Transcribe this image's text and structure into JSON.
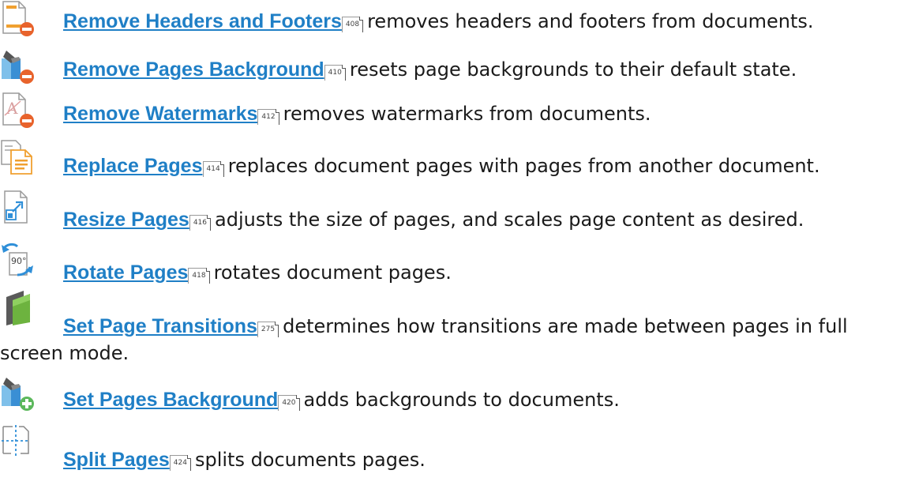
{
  "items": [
    {
      "link": "Remove Headers and Footers",
      "page": "408",
      "text": "removes headers and footers from documents.",
      "icon": "remove-headers-footers-icon"
    },
    {
      "link": " Remove Pages Background",
      "page": "410",
      "text": "resets page backgrounds to their default state.",
      "icon": "remove-background-icon"
    },
    {
      "link": "Remove Watermarks",
      "page": "412",
      "text": "removes watermarks from documents.",
      "icon": "remove-watermark-icon"
    },
    {
      "link": "Replace Pages",
      "page": "414",
      "text": "replaces document pages with pages from another document.",
      "icon": "replace-pages-icon"
    },
    {
      "link": "Resize Pages",
      "page": "416",
      "text": "adjusts the size of pages, and scales page content as desired.",
      "icon": "resize-pages-icon"
    },
    {
      "link": "Rotate Pages",
      "page": "418",
      "text": "rotates document pages.",
      "icon": "rotate-pages-icon"
    },
    {
      "link": "Set Page Transitions",
      "page": "275",
      "text": "determines how transitions are made between pages in full screen mode.",
      "icon": "page-transitions-icon"
    },
    {
      "link": "Set Pages Background",
      "page": "420",
      "text": "adds backgrounds to documents.",
      "icon": "set-background-icon"
    },
    {
      "link": "Split Pages",
      "page": "424",
      "text": "splits documents pages.",
      "icon": "split-pages-icon"
    }
  ],
  "colors": {
    "link": "#1f7fc6",
    "remove_badge": "#e8632c",
    "add_badge": "#5cb85c",
    "doc_orange": "#f0a030",
    "blue": "#2f8fd8"
  }
}
